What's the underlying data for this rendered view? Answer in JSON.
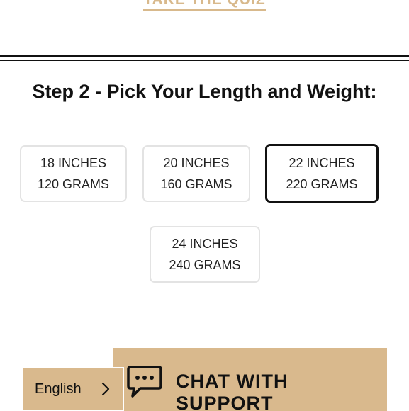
{
  "quiz": {
    "link_label": "TAKE THE QUIZ"
  },
  "step": {
    "title": "Step 2 - Pick Your Length and Weight:"
  },
  "options": [
    {
      "length": "18 INCHES",
      "weight": "120 GRAMS",
      "selected": false
    },
    {
      "length": "20 INCHES",
      "weight": "160 GRAMS",
      "selected": false
    },
    {
      "length": "22 INCHES",
      "weight": "220 GRAMS",
      "selected": true
    },
    {
      "length": "24 INCHES",
      "weight": "240 GRAMS",
      "selected": false
    }
  ],
  "chat": {
    "label": "CHAT WITH SUPPORT",
    "icon": "chat-bubble-icon"
  },
  "language": {
    "label": "English",
    "icon": "chevron-right-icon"
  },
  "colors": {
    "accent": "#d9b98d",
    "quiz_link": "#d8b98c",
    "text": "#111111",
    "border": "#e3e3e3"
  }
}
